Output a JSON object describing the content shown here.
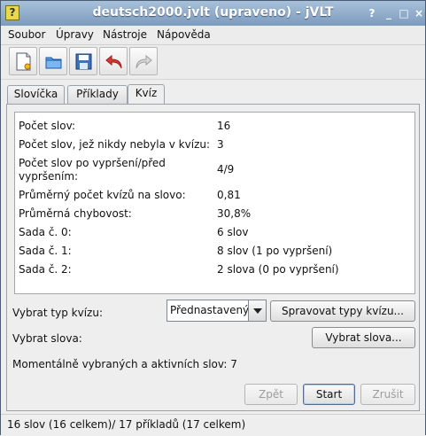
{
  "window": {
    "title": "deutsch2000.jvlt (upraveno) - jVLT",
    "app_icon": "question-document-icon",
    "buttons": [
      "?",
      "_",
      "□",
      "×"
    ]
  },
  "menu": {
    "items": [
      {
        "label": "Soubor"
      },
      {
        "label": "Úpravy"
      },
      {
        "label": "Nástroje"
      },
      {
        "label": "Nápověda"
      }
    ]
  },
  "toolbar": {
    "icons": [
      "new-document-icon",
      "open-folder-icon",
      "save-icon",
      "undo-icon",
      "redo-icon"
    ]
  },
  "tabs": [
    {
      "label": "Slovíčka"
    },
    {
      "label": "Příklady"
    },
    {
      "label": "Kvíz",
      "active": true
    }
  ],
  "stats": [
    {
      "label": "Počet slov:",
      "value": "16"
    },
    {
      "label": "Počet slov, jež nikdy nebyla v kvízu:",
      "value": "3"
    },
    {
      "label": "Počet slov po vypršení/před vypršením:",
      "value": "4/9"
    },
    {
      "label": "Průměrný počet kvízů na slovo:",
      "value": "0,81"
    },
    {
      "label": "Průměrná chybovost:",
      "value": "30,8%"
    },
    {
      "label": "Sada č. 0:",
      "value": "6 slov"
    },
    {
      "label": "Sada č. 1:",
      "value": "8 slov (1 po vypršení)"
    },
    {
      "label": "Sada č. 2:",
      "value": "2 slova (0 po vypršení)"
    }
  ],
  "quiz": {
    "type_label": "Vybrat typ kvízu:",
    "type_value": "Přednastavený",
    "manage_types_button": "Spravovat typy kvízu...",
    "words_label": "Vybrat slova:",
    "select_words_button": "Vybrat slova...",
    "active_label": "Momentálně vybraných a aktivních slov: 7",
    "back_button": "Zpět",
    "start_button": "Start",
    "cancel_button": "Zrušit"
  },
  "status": {
    "text": "16 slov (16 celkem)/ 17 příkladů (17 celkem)"
  },
  "colors": {
    "titlebar": "#7d9bbd",
    "window": "#eeeeee",
    "undo_icon": "#d33a32"
  }
}
